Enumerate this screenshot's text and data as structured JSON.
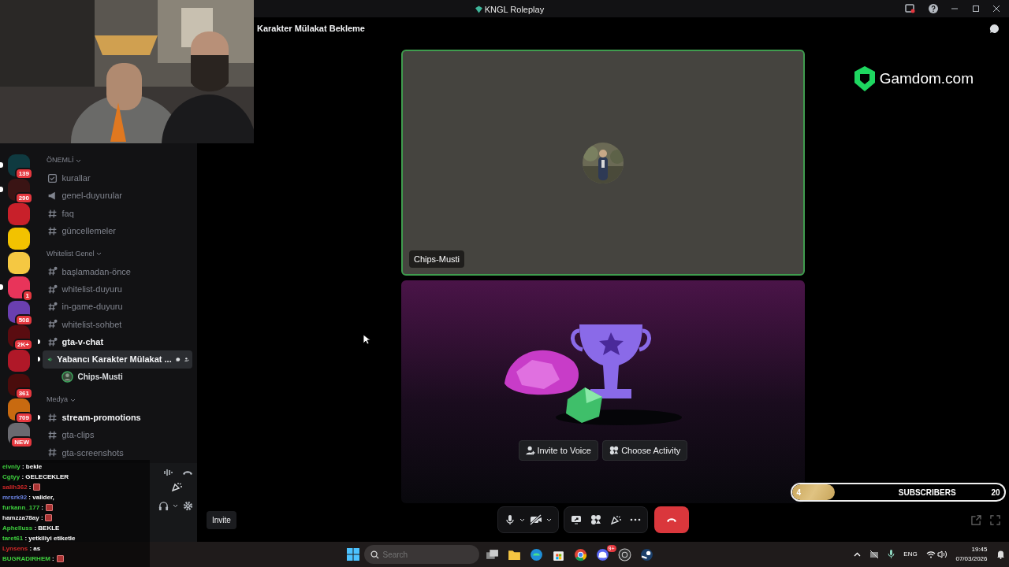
{
  "window": {
    "title": "KNGL Roleplay"
  },
  "servers": [
    {
      "color": "#0f3a40",
      "badge": "139",
      "unread": true
    },
    {
      "color": "#3a1414",
      "badge": "290",
      "unread": true
    },
    {
      "color": "#c8202a",
      "unread": false
    },
    {
      "color": "#f2c200",
      "unread": false
    },
    {
      "color": "#f5c842",
      "unread": false
    },
    {
      "color": "#e8345a",
      "badge": "1",
      "unread": true
    },
    {
      "color": "#6a3fb0",
      "badge": "508",
      "unread": false
    },
    {
      "color": "#5a0c10",
      "badge": "2K+",
      "unread": false
    },
    {
      "color": "#b01828",
      "unread": false
    },
    {
      "color": "#4a0c0c",
      "badge": "361",
      "unread": false
    },
    {
      "color": "#c86a10",
      "badge": "709",
      "unread": false
    },
    {
      "color": "#6a6a70",
      "badge": "NEW",
      "unread": false
    }
  ],
  "channel_list": [
    {
      "category": "ÖNEMLİ",
      "channels": [
        {
          "kind": "rules",
          "name": "kurallar",
          "unread": false,
          "selected": false
        },
        {
          "kind": "announcement",
          "name": "genel-duyurular",
          "unread": false,
          "selected": false
        },
        {
          "kind": "text",
          "name": "faq",
          "unread": false,
          "selected": false
        },
        {
          "kind": "text",
          "name": "güncellemeler",
          "unread": false,
          "selected": false
        }
      ]
    },
    {
      "category": "Whitelist Genel",
      "channels": [
        {
          "kind": "thread",
          "name": "başlamadan-önce",
          "unread": false,
          "selected": false
        },
        {
          "kind": "thread",
          "name": "whitelist-duyuru",
          "unread": false,
          "selected": false
        },
        {
          "kind": "thread",
          "name": "in-game-duyuru",
          "unread": false,
          "selected": false
        },
        {
          "kind": "thread",
          "name": "whitelist-sohbet",
          "unread": false,
          "selected": false
        },
        {
          "kind": "thread",
          "name": "gta-v-chat",
          "unread": true,
          "selected": false
        },
        {
          "kind": "voice",
          "name": "Yabancı Karakter Mülakat ...",
          "unread": true,
          "selected": true,
          "members": [
            {
              "name": "Chips-Musti"
            }
          ]
        }
      ]
    },
    {
      "category": "Medya",
      "channels": [
        {
          "kind": "text",
          "name": "stream-promotions",
          "unread": true,
          "selected": false
        },
        {
          "kind": "text",
          "name": "gta-clips",
          "unread": false,
          "selected": false
        },
        {
          "kind": "text",
          "name": "gta-screenshots",
          "unread": false,
          "selected": false
        }
      ]
    }
  ],
  "chat": [
    {
      "user": "elvnly",
      "color": "#3ecf3e",
      "text": ": bekle",
      "emote": false
    },
    {
      "user": "Cgtyy",
      "color": "#3ecf3e",
      "text": ": GELECEKLER",
      "emote": false
    },
    {
      "user": "salih362",
      "color": "#d02828",
      "text": ":",
      "emote": true
    },
    {
      "user": "mrsrk92",
      "color": "#6a82e0",
      "text": ": valider,",
      "emote": false
    },
    {
      "user": "furkann_177",
      "color": "#3ecf3e",
      "text": ":",
      "emote": true
    },
    {
      "user": "hamzza78ay",
      "color": "#f0f0f0",
      "text": ":",
      "emote": true
    },
    {
      "user": "Aphelluss",
      "color": "#3ecf3e",
      "text": ": BEKLE",
      "emote": false
    },
    {
      "user": "taret61",
      "color": "#3ecf3e",
      "text": ": yetkiliyi etiketle",
      "emote": false
    },
    {
      "user": "Lynsens",
      "color": "#d02828",
      "text": ": as",
      "emote": false
    },
    {
      "user": "BUGRADIRHEM",
      "color": "#3ecf3e",
      "text": ":",
      "emote": true
    }
  ],
  "header": {
    "channel_title": "Karakter Mülakat Bekleme"
  },
  "video_tile": {
    "name": "Chips-Musti",
    "speaking": true
  },
  "activity_tile": {
    "buttons": [
      "Invite to Voice",
      "Choose Activity"
    ]
  },
  "controls": {
    "invite": "Invite",
    "muted": false,
    "camera_on": false
  },
  "sponsor": {
    "logo_text": "Gamdom.com"
  },
  "subscribers": {
    "count": "4",
    "label": "SUBSCRIBERS",
    "goal": "20",
    "level": 0.2
  },
  "taskbar": {
    "search_placeholder": "Search",
    "discord_badge": "9+",
    "language": "ENG",
    "time": "19:45",
    "date": "07/03/2026"
  }
}
